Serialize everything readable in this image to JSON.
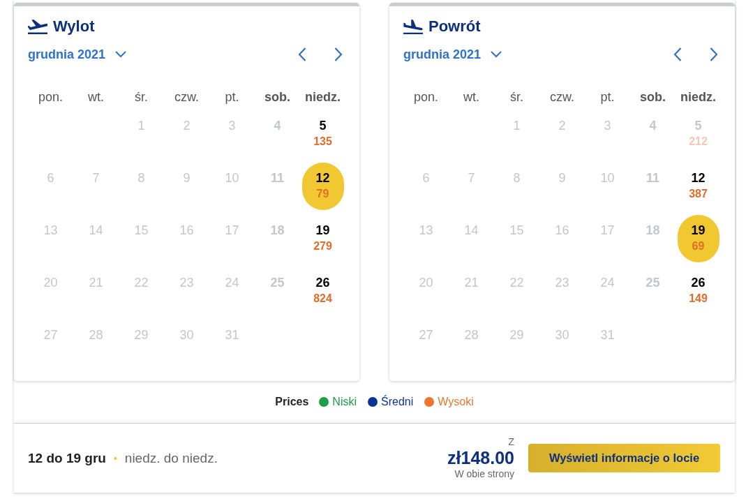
{
  "calendars": [
    {
      "kind": "departure",
      "title": "Wylot",
      "month": "grudnia 2021",
      "weekdays": [
        {
          "label": "pon.",
          "weekend": false
        },
        {
          "label": "wt.",
          "weekend": false
        },
        {
          "label": "śr.",
          "weekend": false
        },
        {
          "label": "czw.",
          "weekend": false
        },
        {
          "label": "pt.",
          "weekend": false
        },
        {
          "label": "sob.",
          "weekend": true
        },
        {
          "label": "niedz.",
          "weekend": true
        }
      ],
      "weeks": [
        {
          "days": [
            {
              "day": "1",
              "disabled": true,
              "selected": false
            },
            {
              "day": "2",
              "disabled": true,
              "selected": false
            },
            {
              "day": "3",
              "disabled": true,
              "selected": false
            },
            {
              "day": "4",
              "disabled": true,
              "selected": false
            },
            {
              "day": "5",
              "price": "135",
              "color": "#e26c2a",
              "disabled": false,
              "selected": false
            }
          ]
        },
        {
          "days": [
            {
              "day": "6",
              "disabled": true,
              "selected": false
            },
            {
              "day": "7",
              "disabled": true,
              "selected": false
            },
            {
              "day": "8",
              "disabled": true,
              "selected": false
            },
            {
              "day": "9",
              "disabled": true,
              "selected": false
            },
            {
              "day": "10",
              "disabled": true,
              "selected": false
            },
            {
              "day": "11",
              "disabled": true,
              "selected": false
            },
            {
              "day": "12",
              "price": "79",
              "color": "#e26c2a",
              "disabled": false,
              "selected": true
            }
          ]
        },
        {
          "days": [
            {
              "day": "13",
              "disabled": true,
              "selected": false
            },
            {
              "day": "14",
              "disabled": true,
              "selected": false
            },
            {
              "day": "15",
              "disabled": true,
              "selected": false
            },
            {
              "day": "16",
              "disabled": true,
              "selected": false
            },
            {
              "day": "17",
              "disabled": true,
              "selected": false
            },
            {
              "day": "18",
              "disabled": true,
              "selected": false
            },
            {
              "day": "19",
              "price": "279",
              "color": "#e26c2a",
              "disabled": false,
              "selected": false
            }
          ]
        },
        {
          "days": [
            {
              "day": "20",
              "disabled": true,
              "selected": false
            },
            {
              "day": "21",
              "disabled": true,
              "selected": false
            },
            {
              "day": "22",
              "disabled": true,
              "selected": false
            },
            {
              "day": "23",
              "disabled": true,
              "selected": false
            },
            {
              "day": "24",
              "disabled": true,
              "selected": false
            },
            {
              "day": "25",
              "disabled": true,
              "selected": false
            },
            {
              "day": "26",
              "price": "824",
              "color": "#e26c2a",
              "disabled": false,
              "selected": false
            }
          ]
        },
        {
          "days": [
            {
              "day": "27",
              "disabled": true,
              "selected": false
            },
            {
              "day": "28",
              "disabled": true,
              "selected": false
            },
            {
              "day": "29",
              "disabled": true,
              "selected": false
            },
            {
              "day": "30",
              "disabled": true,
              "selected": false
            },
            {
              "day": "31",
              "disabled": true,
              "selected": false
            }
          ]
        }
      ]
    },
    {
      "kind": "arrival",
      "title": "Powrót",
      "month": "grudnia 2021",
      "weekdays": [
        {
          "label": "pon.",
          "weekend": false
        },
        {
          "label": "wt.",
          "weekend": false
        },
        {
          "label": "śr.",
          "weekend": false
        },
        {
          "label": "czw.",
          "weekend": false
        },
        {
          "label": "pt.",
          "weekend": false
        },
        {
          "label": "sob.",
          "weekend": true
        },
        {
          "label": "niedz.",
          "weekend": true
        }
      ],
      "weeks": [
        {
          "days": [
            {
              "day": "1",
              "disabled": true,
              "selected": false
            },
            {
              "day": "2",
              "disabled": true,
              "selected": false
            },
            {
              "day": "3",
              "disabled": true,
              "selected": false
            },
            {
              "day": "4",
              "disabled": true,
              "selected": false
            },
            {
              "day": "5",
              "price": "212",
              "color": "#f4c8b3",
              "disabled": true,
              "selected": false
            }
          ]
        },
        {
          "days": [
            {
              "day": "6",
              "disabled": true,
              "selected": false
            },
            {
              "day": "7",
              "disabled": true,
              "selected": false
            },
            {
              "day": "8",
              "disabled": true,
              "selected": false
            },
            {
              "day": "9",
              "disabled": true,
              "selected": false
            },
            {
              "day": "10",
              "disabled": true,
              "selected": false
            },
            {
              "day": "11",
              "disabled": true,
              "selected": false
            },
            {
              "day": "12",
              "price": "387",
              "color": "#e26c2a",
              "disabled": false,
              "selected": false
            }
          ]
        },
        {
          "days": [
            {
              "day": "13",
              "disabled": true,
              "selected": false
            },
            {
              "day": "14",
              "disabled": true,
              "selected": false
            },
            {
              "day": "15",
              "disabled": true,
              "selected": false
            },
            {
              "day": "16",
              "disabled": true,
              "selected": false
            },
            {
              "day": "17",
              "disabled": true,
              "selected": false
            },
            {
              "day": "18",
              "disabled": true,
              "selected": false
            },
            {
              "day": "19",
              "price": "69",
              "color": "#e26c2a",
              "disabled": false,
              "selected": true
            }
          ]
        },
        {
          "days": [
            {
              "day": "20",
              "disabled": true,
              "selected": false
            },
            {
              "day": "21",
              "disabled": true,
              "selected": false
            },
            {
              "day": "22",
              "disabled": true,
              "selected": false
            },
            {
              "day": "23",
              "disabled": true,
              "selected": false
            },
            {
              "day": "24",
              "disabled": true,
              "selected": false
            },
            {
              "day": "25",
              "disabled": true,
              "selected": false
            },
            {
              "day": "26",
              "price": "149",
              "color": "#e26c2a",
              "disabled": false,
              "selected": false
            }
          ]
        },
        {
          "days": [
            {
              "day": "27",
              "disabled": true,
              "selected": false
            },
            {
              "day": "28",
              "disabled": true,
              "selected": false
            },
            {
              "day": "29",
              "disabled": true,
              "selected": false
            },
            {
              "day": "30",
              "disabled": true,
              "selected": false
            },
            {
              "day": "31",
              "disabled": true,
              "selected": false
            }
          ]
        }
      ]
    }
  ],
  "legend": {
    "label": "Prices",
    "items": [
      {
        "label": "Niski",
        "color": "#1f9e4a"
      },
      {
        "label": "Średni",
        "color": "#0b3590"
      },
      {
        "label": "Wysoki",
        "color": "#ec762e"
      }
    ]
  },
  "summary": {
    "dates": "12 do 19 gru",
    "separator": "•",
    "days": "niedz. do niedz.",
    "price_caption": "Z",
    "price": "zł148.00",
    "price_note": "W obie strony",
    "button": "Wyświetl informacje o locie"
  }
}
